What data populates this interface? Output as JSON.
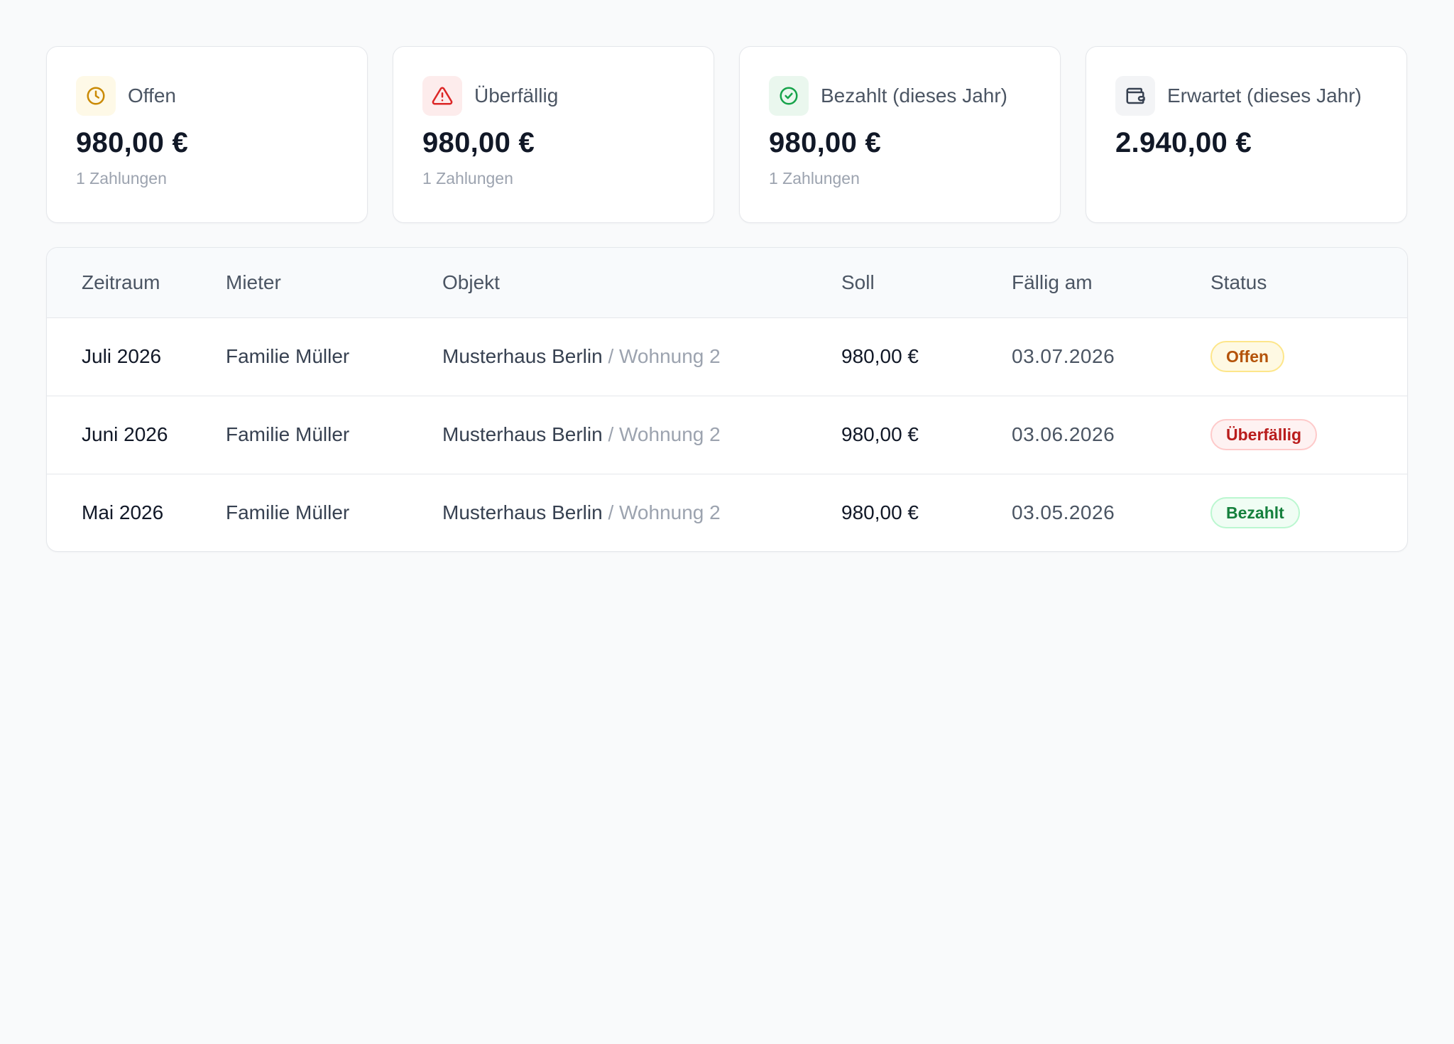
{
  "summary": [
    {
      "icon": "clock-icon",
      "title": "Offen",
      "value": "980,00 €",
      "sub": "1 Zahlungen",
      "color": "#ca8a04"
    },
    {
      "icon": "warning-triangle-icon",
      "title": "Überfällig",
      "value": "980,00 €",
      "sub": "1 Zahlungen",
      "color": "#dc2626"
    },
    {
      "icon": "check-circle-icon",
      "title": "Bezahlt (dieses Jahr)",
      "value": "980,00 €",
      "sub": "1 Zahlungen",
      "color": "#16a34a"
    },
    {
      "icon": "wallet-icon",
      "title": "Erwartet (dieses Jahr)",
      "value": "2.940,00 €",
      "sub": "",
      "color": "#374151"
    }
  ],
  "table": {
    "headers": {
      "period": "Zeitraum",
      "tenant": "Mieter",
      "property": "Objekt",
      "amount": "Soll",
      "due": "Fällig am",
      "status": "Status"
    },
    "rows": [
      {
        "period": "Juli 2026",
        "tenant": "Familie Müller",
        "property": "Musterhaus Berlin",
        "unit": "/ Wohnung 2",
        "amount": "980,00 €",
        "due": "03.07.2026",
        "status": "Offen"
      },
      {
        "period": "Juni 2026",
        "tenant": "Familie Müller",
        "property": "Musterhaus Berlin",
        "unit": "/ Wohnung 2",
        "amount": "980,00 €",
        "due": "03.06.2026",
        "status": "Überfällig"
      },
      {
        "period": "Mai 2026",
        "tenant": "Familie Müller",
        "property": "Musterhaus Berlin",
        "unit": "/ Wohnung 2",
        "amount": "980,00 €",
        "due": "03.05.2026",
        "status": "Bezahlt"
      }
    ]
  },
  "status_colors": {
    "Offen": "#b45309",
    "Überfällig": "#b91c1c",
    "Bezahlt": "#15803d"
  }
}
